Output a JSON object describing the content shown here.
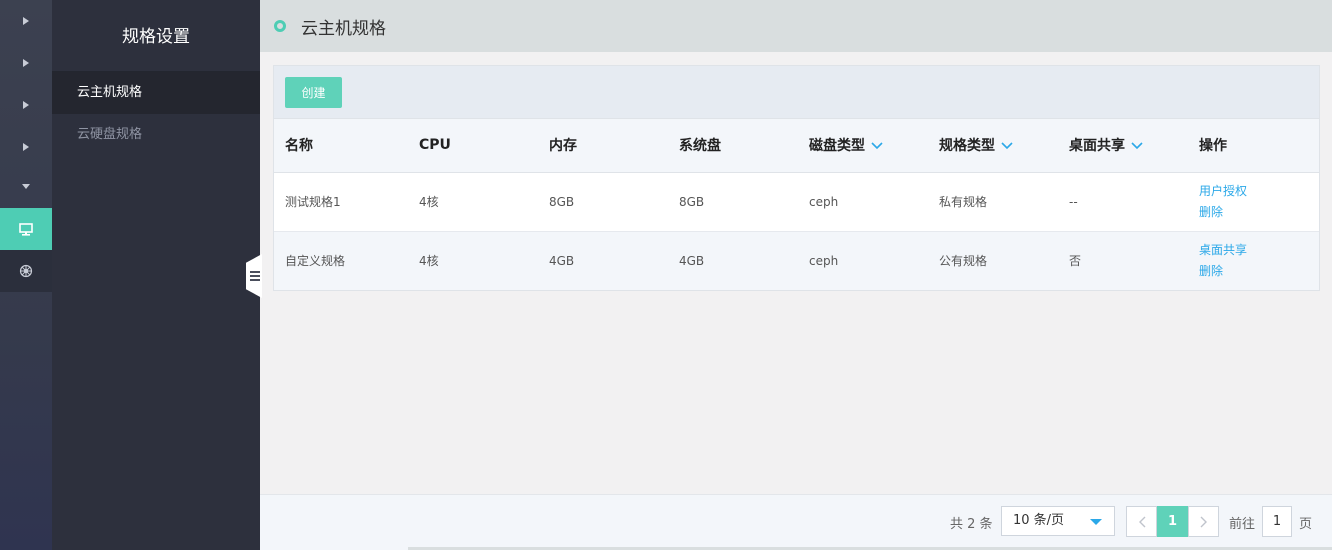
{
  "rail": {
    "items": [
      {
        "icon": "caret-right-icon"
      },
      {
        "icon": "caret-right-icon"
      },
      {
        "icon": "caret-right-icon"
      },
      {
        "icon": "caret-right-icon"
      },
      {
        "icon": "caret-down-icon"
      },
      {
        "icon": "monitor-icon",
        "active": true
      },
      {
        "icon": "helm-wheel-icon"
      }
    ]
  },
  "sidebar": {
    "title": "规格设置",
    "items": [
      {
        "label": "云主机规格",
        "active": true
      },
      {
        "label": "云硬盘规格",
        "active": false
      }
    ]
  },
  "header": {
    "title": "云主机规格"
  },
  "toolbar": {
    "create_label": "创建"
  },
  "table": {
    "columns": [
      "名称",
      "CPU",
      "内存",
      "系统盘",
      "磁盘类型",
      "规格类型",
      "桌面共享",
      "操作"
    ],
    "rows": [
      {
        "name": "测试规格1",
        "cpu": "4核",
        "memory": "8GB",
        "disk": "8GB",
        "disk_type": "ceph",
        "spec_type": "私有规格",
        "desktop_share": "--",
        "actions": [
          "用户授权",
          "删除"
        ]
      },
      {
        "name": "自定义规格",
        "cpu": "4核",
        "memory": "4GB",
        "disk": "4GB",
        "disk_type": "ceph",
        "spec_type": "公有规格",
        "desktop_share": "否",
        "actions": [
          "桌面共享",
          "删除"
        ]
      }
    ]
  },
  "pagination": {
    "total_text": "共 2 条",
    "page_size": "10 条/页",
    "prev": "<",
    "current_page": "1",
    "next": ">",
    "goto_label": "前往",
    "goto_value": "1",
    "page_suffix": "页"
  },
  "colors": {
    "accent": "#4ecdb4",
    "link": "#2ba8e8",
    "sidebar": "#2d303d"
  }
}
